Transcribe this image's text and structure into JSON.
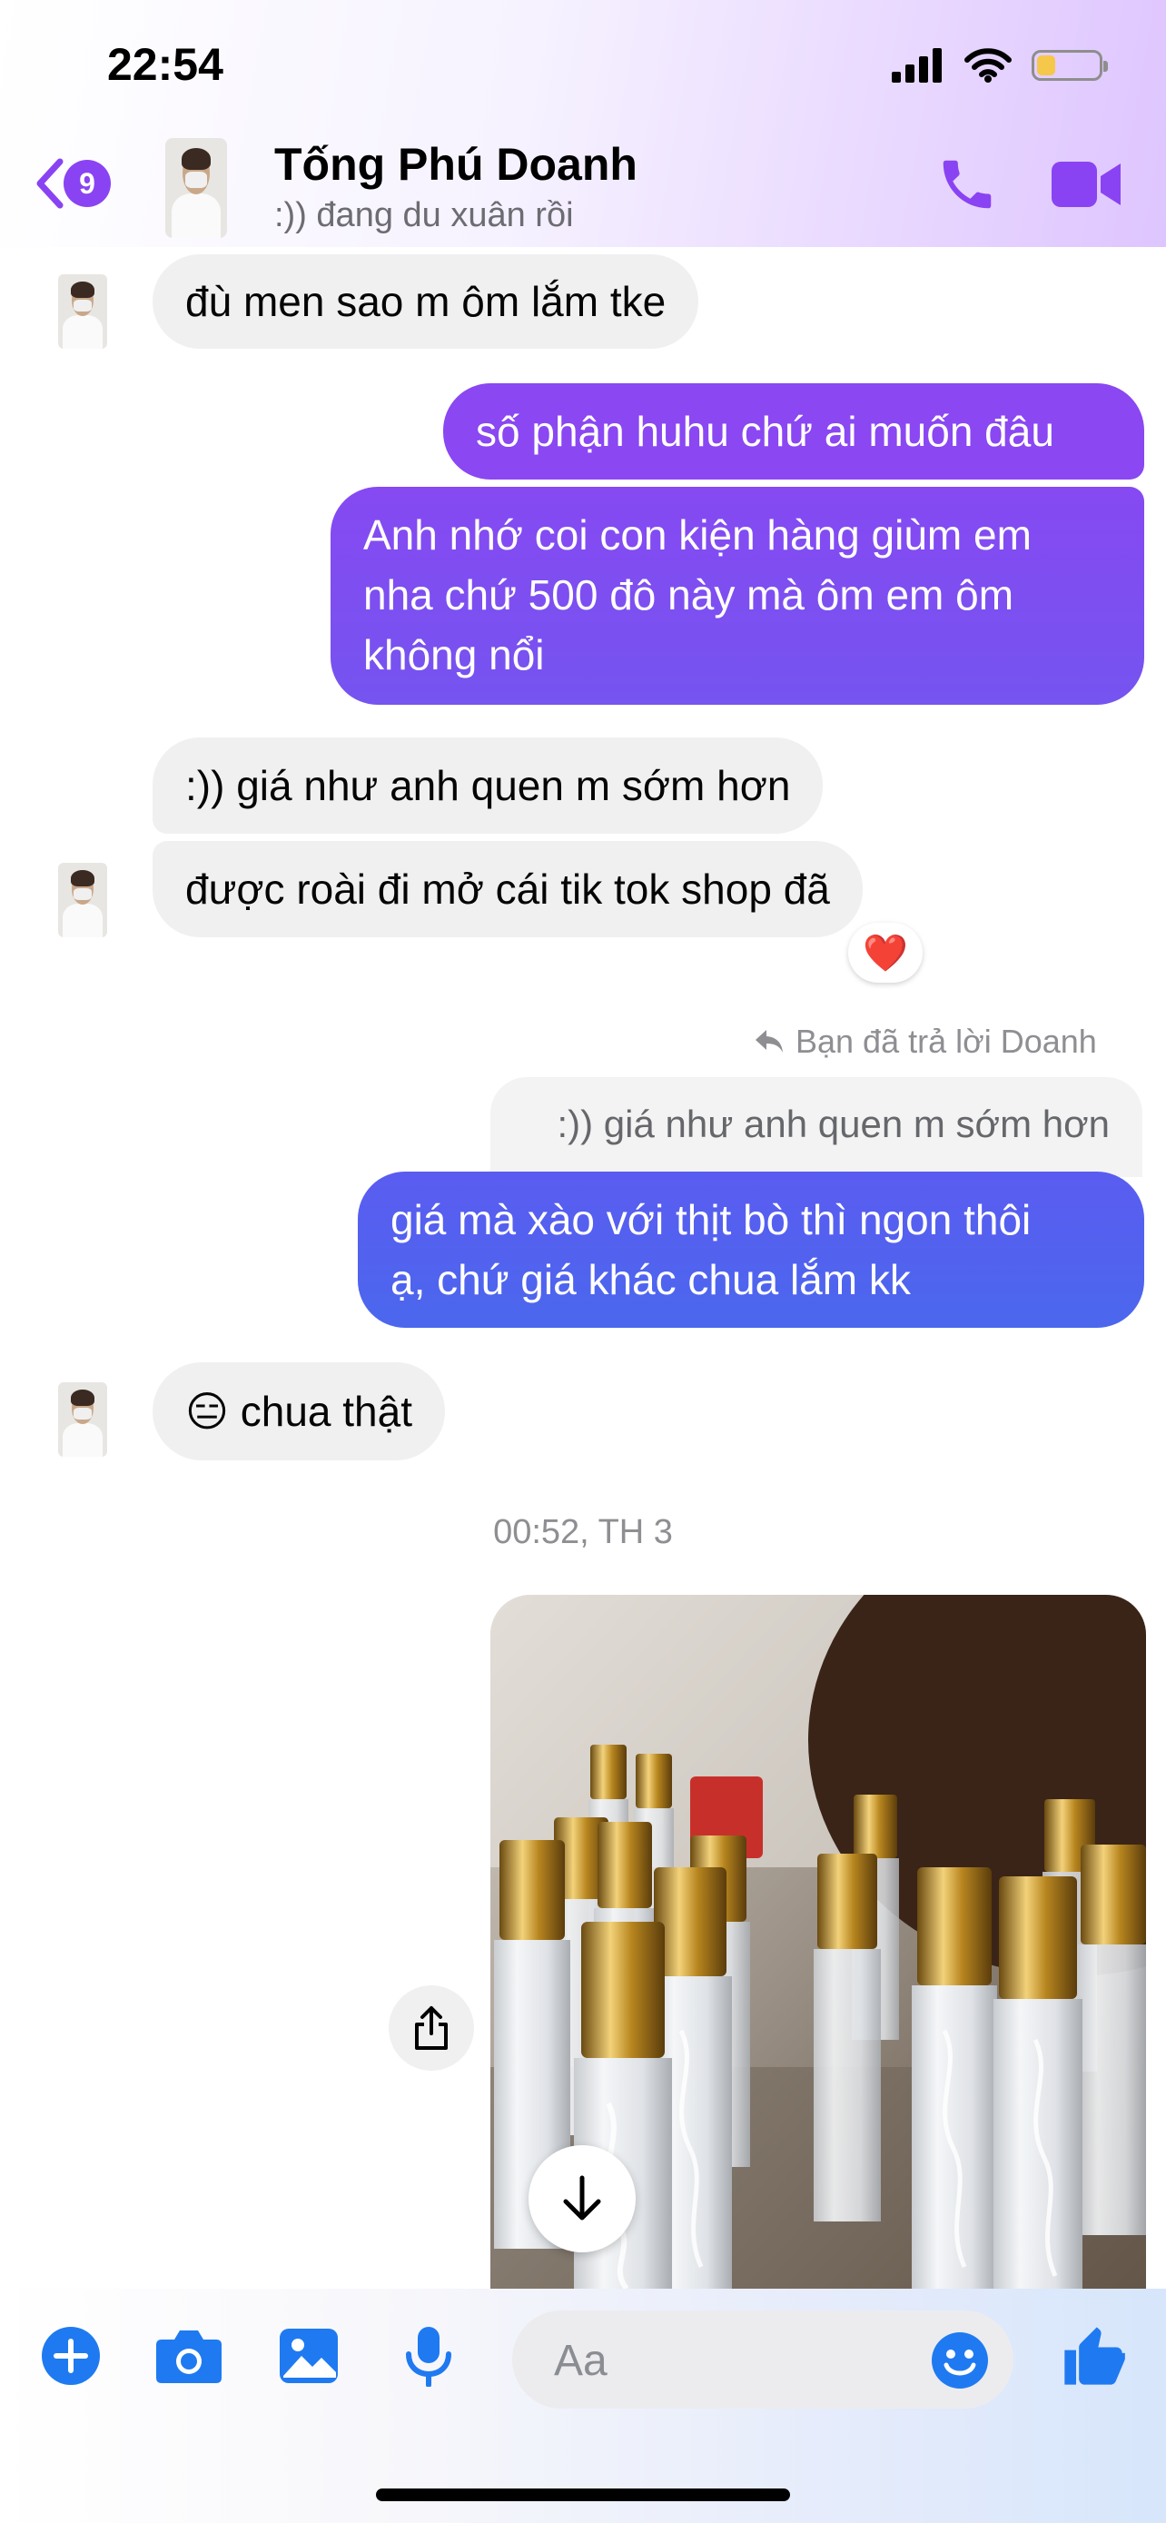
{
  "status_bar": {
    "time": "22:54",
    "battery_level": 0.3
  },
  "header": {
    "back_badge": "9",
    "contact_name": "Tống Phú Doanh",
    "contact_status": ":)) đang du xuân rồi"
  },
  "messages": {
    "m1": ":đù men sao m ôm lắm tke",
    "m2": "số phận huhu chứ ai muốn đâu",
    "m3_lines": [
      "Anh nhớ coi con kiện hàng giùm em",
      "nha chứ 500 đô này mà ôm em ôm",
      "không nổi"
    ],
    "m4": ":)) giá như anh quen m sớm hơn",
    "m5": "được roài đi mở cái tik tok shop đã",
    "m5_reaction": "❤️",
    "reply_note": "Bạn đã trả lời Doanh",
    "quoted_text": ":)) giá như anh quen m sớm hơn",
    "m6_lines": [
      "giá mà xào với thịt bò thì ngon thôi",
      "ạ, chứ giá khác chua lắm kk"
    ],
    "m7_emoji": "😑",
    "m7_text": "chua thật",
    "timestamp": "00:52, TH 3"
  },
  "composer": {
    "placeholder": "Aa"
  },
  "colors": {
    "accent": "#8a43f2",
    "outgoing_top": "#8a47f2",
    "outgoing_bottom": "#4f63ee",
    "blue_icons": "#1f7af1"
  },
  "icons": [
    "back-chevron-icon",
    "phone-icon",
    "video-camera-icon",
    "share-icon",
    "arrow-down-icon",
    "plus-icon",
    "camera-icon",
    "image-icon",
    "microphone-icon",
    "smiley-icon",
    "thumbs-up-icon",
    "heart-icon"
  ]
}
